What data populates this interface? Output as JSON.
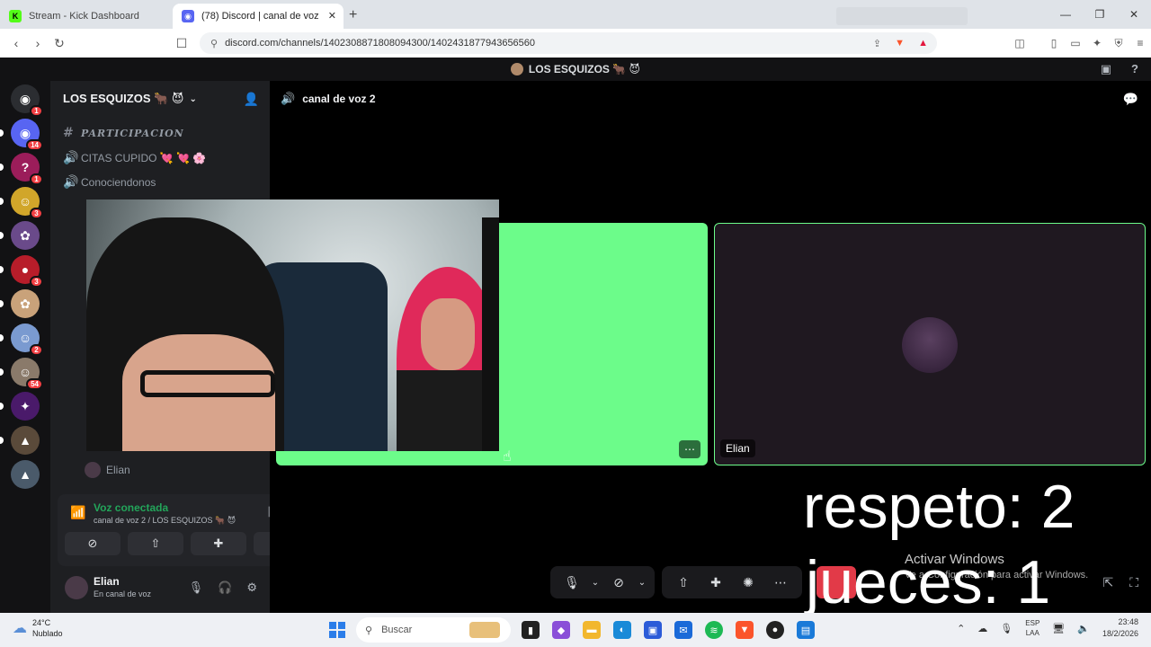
{
  "browser": {
    "tabs": [
      {
        "label": "Stream - Kick Dashboard",
        "active": false,
        "favicon": "kick-icon"
      },
      {
        "label": "(78) Discord | canal de voz 2 |",
        "active": true,
        "favicon": "discord-icon"
      }
    ],
    "url": "discord.com/channels/1402308871808094300/1402431877943656560"
  },
  "discord": {
    "guild_title": "LOS ESQUIZOS 🐂 😈",
    "guild_header": "LOS ESQUIZOS 🐂 😈",
    "servers": [
      {
        "name": "direct-messages",
        "badge": "1",
        "color": "#2b2d31"
      },
      {
        "name": "discord-server",
        "badge": "14",
        "color": "#5865f2"
      },
      {
        "name": "question-server",
        "badge": "1",
        "color": "#9b1d5a"
      },
      {
        "name": "lego-server",
        "badge": "3",
        "color": "#d1a62a"
      },
      {
        "name": "anime-server",
        "badge": "",
        "color": "#6a4a8a"
      },
      {
        "name": "red-server",
        "badge": "3",
        "color": "#b81d2a"
      },
      {
        "name": "blonde-server",
        "badge": "",
        "color": "#c9a27a"
      },
      {
        "name": "character-server",
        "badge": "2",
        "color": "#7a9ad0"
      },
      {
        "name": "face-server",
        "badge": "54",
        "color": "#8a7a6a"
      },
      {
        "name": "venom-server",
        "badge": "",
        "color": "#4a1a6a"
      },
      {
        "name": "game-server",
        "badge": "",
        "color": "#5a4a3a"
      },
      {
        "name": "game-server-2",
        "badge": "",
        "color": "#4a5a6a"
      }
    ],
    "channels": [
      {
        "icon": "#",
        "label": "PARTICIPACION",
        "style": "italic"
      },
      {
        "icon": "🔊",
        "label": "CITAS CUPIDO 💘 💘 🌸",
        "style": "normal"
      },
      {
        "icon": "🔊",
        "label": "Conociendonos",
        "style": "normal"
      }
    ],
    "voice_member": "Elian",
    "voice_panel": {
      "status": "Voz conectada",
      "sub": "canal de voz 2 / LOS ESQUIZOS 🐂 😈"
    },
    "user": {
      "name": "Elian",
      "status": "En canal de voz"
    },
    "stage": {
      "channel_name": "canal de voz 2",
      "tile2_name": "Elian"
    }
  },
  "overlay": {
    "line1": "respeto: 2",
    "line2": "jueces: 1",
    "activate_title": "Activar Windows",
    "activate_sub": "Ve a Configuración para activar Windows."
  },
  "taskbar": {
    "temp": "24°C",
    "weather": "Nublado",
    "search_placeholder": "Buscar",
    "lang1": "ESP",
    "lang2": "LAA",
    "time": "23:48",
    "date": "18/2/2026"
  }
}
